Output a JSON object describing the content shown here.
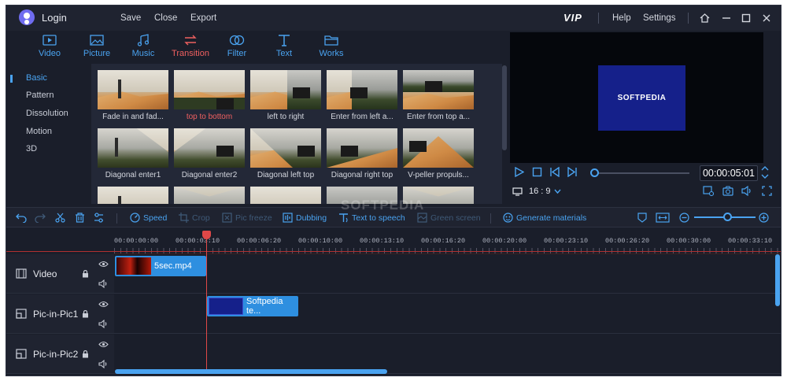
{
  "titlebar": {
    "login": "Login",
    "menu": [
      "Save",
      "Close",
      "Export"
    ],
    "vip": "VIP",
    "help": "Help",
    "settings": "Settings"
  },
  "categories": [
    {
      "label": "Video",
      "icon": "video-icon"
    },
    {
      "label": "Picture",
      "icon": "picture-icon"
    },
    {
      "label": "Music",
      "icon": "music-icon"
    },
    {
      "label": "Transition",
      "icon": "transition-icon",
      "active": true
    },
    {
      "label": "Filter",
      "icon": "filter-icon"
    },
    {
      "label": "Text",
      "icon": "text-icon"
    },
    {
      "label": "Works",
      "icon": "folder-icon"
    }
  ],
  "sidebar": {
    "items": [
      "Basic",
      "Pattern",
      "Dissolution",
      "Motion",
      "3D"
    ],
    "active": "Basic"
  },
  "transitions": [
    "Fade in and fad...",
    "top to bottom",
    "left to right",
    "Enter from left a...",
    "Enter from top a...",
    "Diagonal enter1",
    "Diagonal enter2",
    "Diagonal left top",
    "Diagonal right top",
    "V-peller propuls..."
  ],
  "selected_transition": "top to bottom",
  "preview": {
    "card_text": "SOFTPEDIA",
    "time": "00:00:05:01",
    "ratio": "16 : 9"
  },
  "toolbar": {
    "speed": "Speed",
    "crop": "Crop",
    "pic_freeze": "Pic freeze",
    "dubbing": "Dubbing",
    "text_to_speech": "Text to speech",
    "green_screen": "Green screen",
    "generate_materials": "Generate materials"
  },
  "ruler": [
    "00:00:00:00",
    "00:00:03:10",
    "00:00:06:20",
    "00:00:10:00",
    "00:00:13:10",
    "00:00:16:20",
    "00:00:20:00",
    "00:00:23:10",
    "00:00:26:20",
    "00:00:30:00",
    "00:00:33:10"
  ],
  "tracks": [
    {
      "name": "Video",
      "clip": "5sec.mp4"
    },
    {
      "name": "Pic-in-Pic1",
      "clip": "Softpedia te..."
    },
    {
      "name": "Pic-in-Pic2",
      "clip": ""
    }
  ],
  "watermark": "SOFTPEDIA",
  "colors": {
    "accent": "#4aa3f0",
    "active": "#f06060",
    "bg": "#1a1e2a",
    "clip": "#2e8fe0"
  }
}
